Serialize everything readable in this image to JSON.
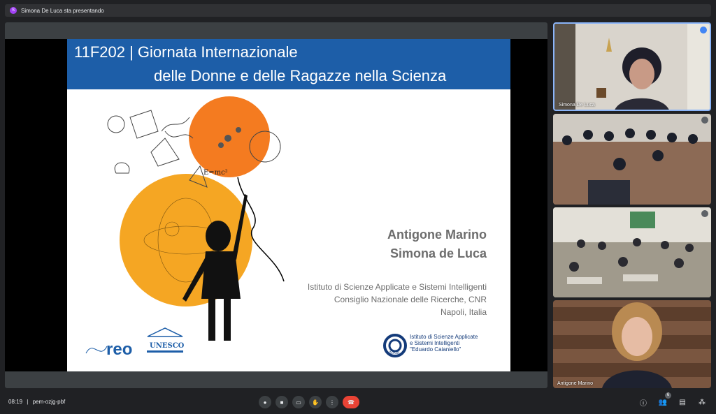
{
  "topbar": {
    "avatar_letter": "S",
    "presenting_text": "Simona De Luca sta presentando"
  },
  "slide": {
    "title_line1": "11F202 | Giornata Internazionale",
    "title_line2": "delle Donne e delle Ragazze nella Scienza",
    "author1": "Antigone Marino",
    "author2": "Simona de Luca",
    "institution_line1": "Istituto di Scienze Applicate e Sistemi Intelligenti",
    "institution_line2": "Consiglio Nazionale delle Ricerche, CNR",
    "institution_line3": "Napoli, Italia",
    "isasi_logo_line1": "Istituto di Scienze Applicate",
    "isasi_logo_line2": "e Sistemi Intelligenti",
    "isasi_logo_line3": "\"Eduardo Caianiello\"",
    "isasi_mark_text": "ISASI",
    "reo_logo_text": "reo",
    "unesco_logo_text": "UNESCO",
    "formula_text": "E=mc²",
    "header_color": "#1d5ea8",
    "orange": "#f47b20"
  },
  "participants": [
    {
      "name": "Simona De Luca",
      "speaking": true
    },
    {
      "name": "",
      "speaking": false
    },
    {
      "name": "",
      "speaking": false
    },
    {
      "name": "Antigone Marino",
      "speaking": false
    }
  ],
  "bottombar": {
    "time": "08:19",
    "separator": "|",
    "meeting_code": "pem-ozjg-pbf",
    "people_count": "6"
  },
  "controls": [
    "mic-icon",
    "camera-icon",
    "captions-icon",
    "raise-hand-icon",
    "more-icon",
    "end-call-icon"
  ],
  "right_controls": [
    "info-icon",
    "people-icon",
    "chat-icon",
    "activities-icon"
  ]
}
